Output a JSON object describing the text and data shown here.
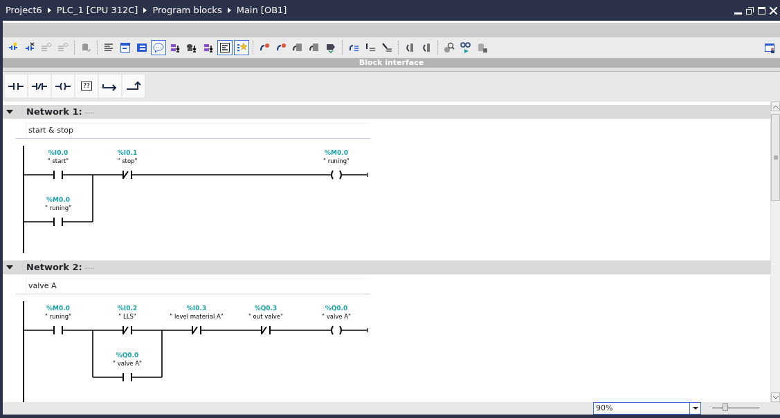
{
  "window": {
    "breadcrumb": [
      "Project6",
      "PLC_1 [CPU 312C]",
      "Program blocks",
      "Main [OB1]"
    ]
  },
  "toolbar": [
    {
      "pressed": false
    },
    {
      "pressed": false
    },
    {
      "pressed": false
    },
    {
      "pressed": false
    },
    {
      "pressed": false
    },
    {
      "pressed": false
    },
    {
      "pressed": false
    },
    {
      "pressed": false
    },
    {
      "pressed": true
    },
    {
      "pressed": false
    },
    {
      "pressed": false
    },
    {
      "pressed": false
    },
    {
      "pressed": true
    },
    {
      "pressed": true
    },
    {
      "pressed": false
    },
    {
      "pressed": false
    },
    {
      "pressed": false
    },
    {
      "pressed": false
    },
    {
      "pressed": false
    },
    {
      "pressed": false
    },
    {
      "pressed": false
    },
    {
      "pressed": false
    },
    {
      "pressed": false
    },
    {
      "pressed": false
    },
    {
      "pressed": false
    },
    {
      "pressed": false
    },
    {
      "pressed": false
    },
    {
      "pressed": false
    }
  ],
  "block_interface": {
    "label": "Block interface"
  },
  "palette": [
    {
      "kind": "contact_no"
    },
    {
      "kind": "contact_nc"
    },
    {
      "kind": "coil"
    },
    {
      "kind": "box",
      "label": "??"
    },
    {
      "kind": "open_branch"
    },
    {
      "kind": "close_branch"
    }
  ],
  "networks": [
    {
      "title": "Network 1:",
      "expanded": true,
      "title_comment": ".....",
      "comment": "start & stop",
      "rung": [
        {
          "kind": "parallel",
          "branches": [
            [
              {
                "kind": "contact_no",
                "address": "%I0.0",
                "symbol": "\" start\""
              }
            ],
            [
              {
                "kind": "contact_no",
                "address": "%M0.0",
                "symbol": "\" runing\""
              }
            ]
          ]
        },
        {
          "kind": "contact_nc",
          "address": "%I0.1",
          "symbol": "\" stop\""
        },
        {
          "kind": "coil",
          "address": "%M0.0",
          "symbol": "\" runing\""
        }
      ]
    },
    {
      "title": "Network 2:",
      "expanded": true,
      "title_comment": ".....",
      "comment": "valve A",
      "rung": [
        {
          "kind": "contact_no",
          "address": "%M0.0",
          "symbol": "\" runing\""
        },
        {
          "kind": "parallel",
          "branches": [
            [
              {
                "kind": "contact_nc",
                "address": "%I0.2",
                "symbol": "\" LLS\""
              }
            ],
            [
              {
                "kind": "contact_no",
                "address": "%Q0.0",
                "symbol": "\" valve A\""
              }
            ]
          ]
        },
        {
          "kind": "contact_nc",
          "address": "%I0.3",
          "symbol": "\" level material A\""
        },
        {
          "kind": "contact_nc",
          "address": "%Q0.3",
          "symbol": "\" out valve\""
        },
        {
          "kind": "coil",
          "address": "%Q0.0",
          "symbol": "\" valve A\""
        }
      ]
    }
  ],
  "status_bar": {
    "zoom": "90%",
    "zoom_slider": {
      "level": 0.28
    }
  }
}
